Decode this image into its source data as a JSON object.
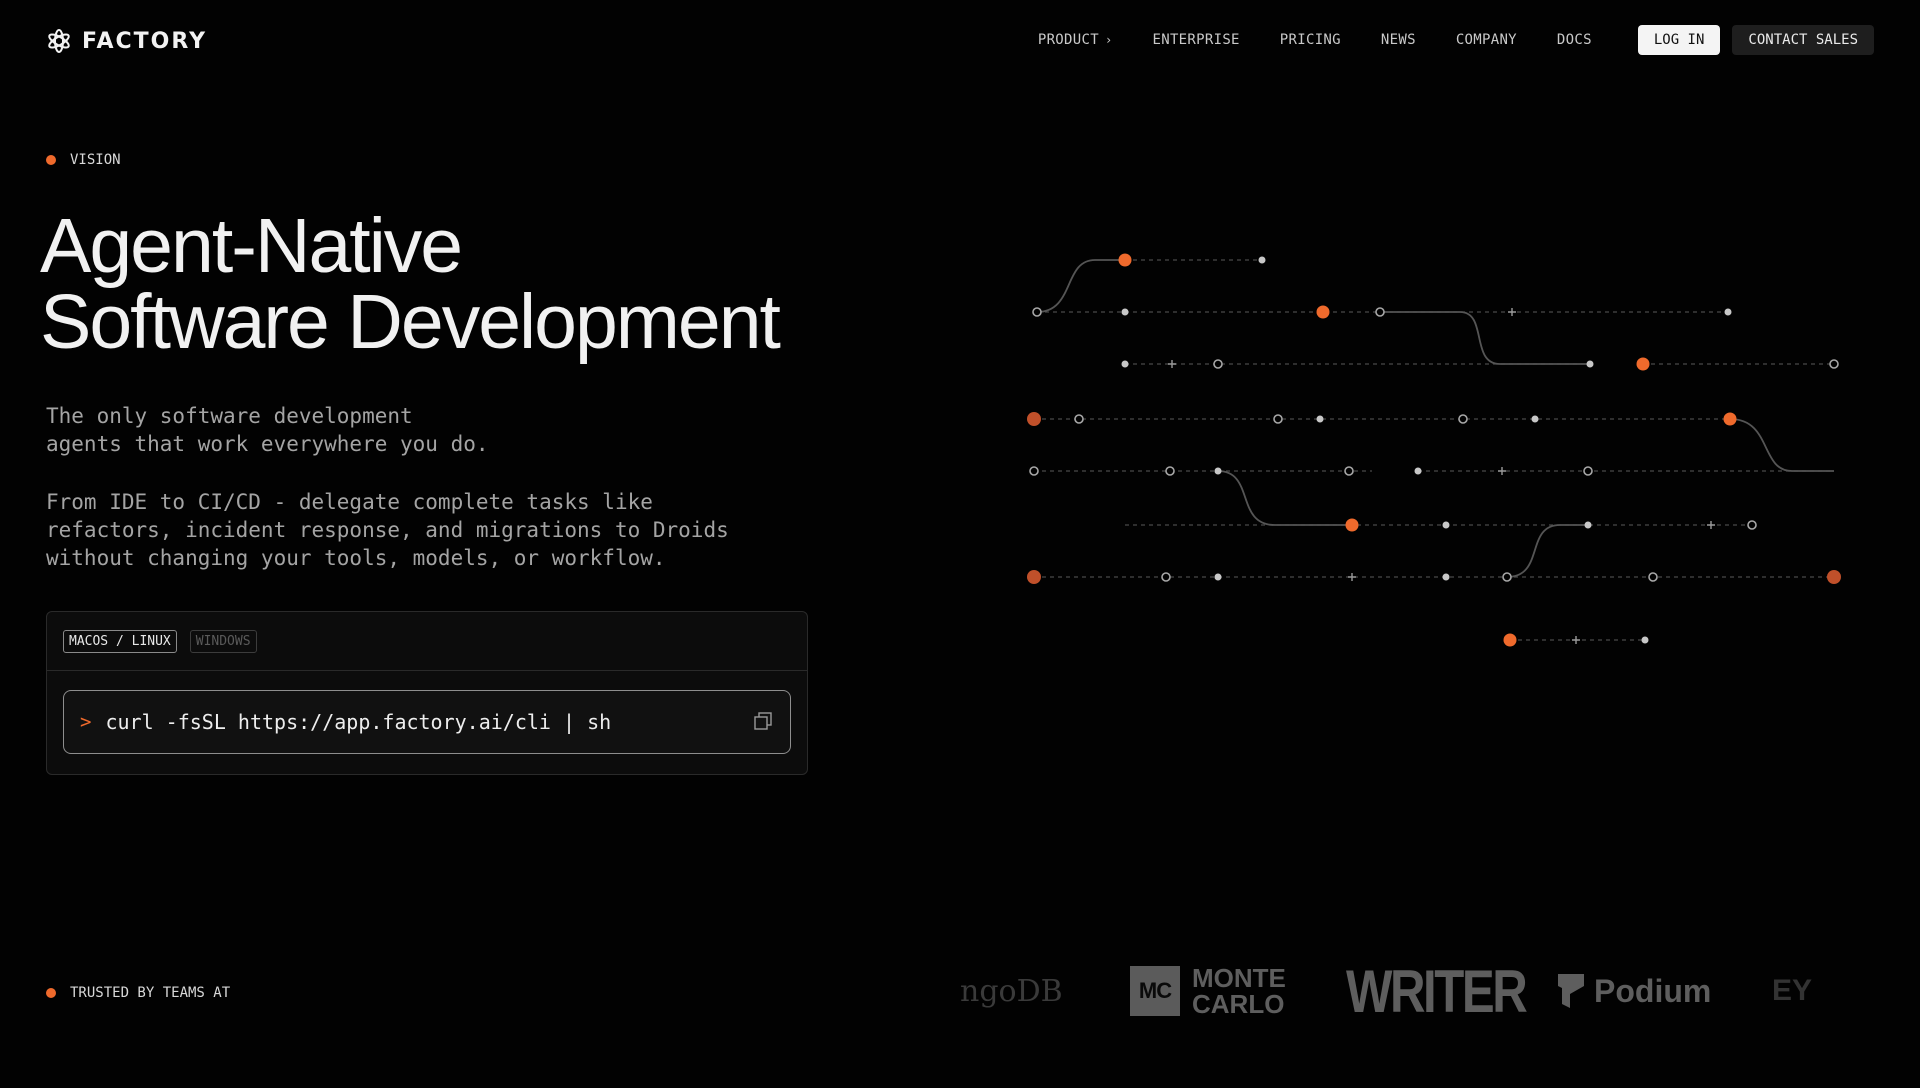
{
  "brand": {
    "name": "FACTORY"
  },
  "nav": {
    "items": [
      "PRODUCT",
      "ENTERPRISE",
      "PRICING",
      "NEWS",
      "COMPANY",
      "DOCS"
    ],
    "login": "LOG IN",
    "contact": "CONTACT SALES"
  },
  "hero": {
    "eyebrow": "VISION",
    "title_line1": "Agent-Native",
    "title_line2": "Software Development",
    "para1": "The only software development\nagents that work everywhere you do.",
    "para2": "From IDE to CI/CD - delegate complete tasks like\nrefactors, incident response, and migrations to Droids\nwithout changing your tools, models, or workflow."
  },
  "install": {
    "tabs": [
      "MACOS / LINUX",
      "WINDOWS"
    ],
    "active_tab": "MACOS / LINUX",
    "prompt": ">",
    "command": "curl -fsSL https://app.factory.ai/cli | sh"
  },
  "trusted": {
    "label": "TRUSTED BY TEAMS AT",
    "logos": [
      "ngoDB",
      "MC",
      "MONTE",
      "CARLO",
      "WRITER",
      "Podium",
      "EY"
    ]
  },
  "colors": {
    "accent": "#ef6a2c",
    "background": "#020202"
  }
}
